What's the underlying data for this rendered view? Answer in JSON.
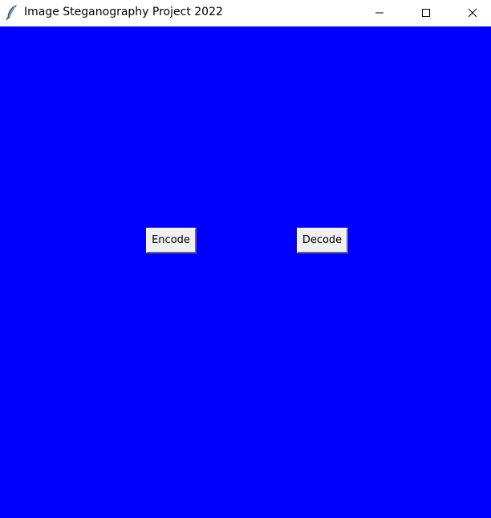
{
  "window": {
    "title": "Image Steganography Project 2022",
    "app_icon": "feather-icon",
    "controls": [
      "minimize-icon",
      "maximize-icon",
      "close-icon"
    ]
  },
  "client": {
    "background_color": "#0000ff"
  },
  "buttons": {
    "encode_label": "Encode",
    "decode_label": "Decode"
  }
}
